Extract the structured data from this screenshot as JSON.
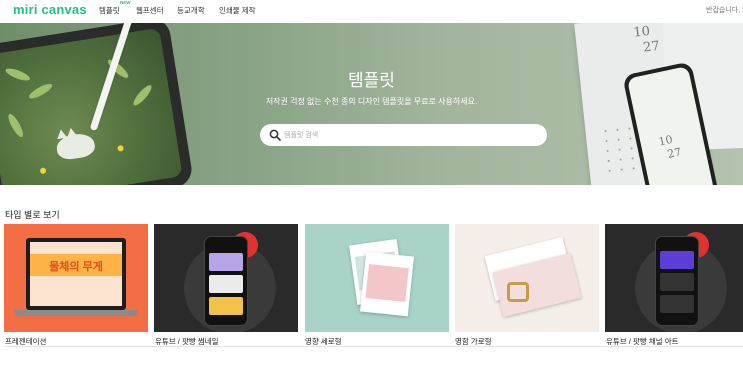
{
  "header": {
    "logo": "miri canvas",
    "nav": [
      {
        "label": "템플릿",
        "badge": "NEW"
      },
      {
        "label": "웹프센터"
      },
      {
        "label": "등교개학"
      },
      {
        "label": "인쇄물 제작"
      }
    ],
    "greeting": "반갑습니다, !"
  },
  "hero": {
    "title": "템플릿",
    "subtitle": "저작권 걱정 없는 수천 종의 디자인 템플릿을 무료로 사용하세요.",
    "search_placeholder": "템플릿 검색",
    "calendar_numbers": [
      "10",
      "27",
      "10",
      "27"
    ],
    "colors": {
      "accent": "#1ebe8c",
      "hero_bg": "#86a183"
    }
  },
  "section": {
    "title": "타입 별로 보기",
    "cards": [
      {
        "label": "프레젠테이션",
        "thumb_text": "물체의 무게"
      },
      {
        "label": "유튜브 / 팟빵 썸네일"
      },
      {
        "label": "영향 세로형"
      },
      {
        "label": "영함 가로형"
      },
      {
        "label": "유튜브 / 팟빵 채널 아트"
      }
    ]
  }
}
